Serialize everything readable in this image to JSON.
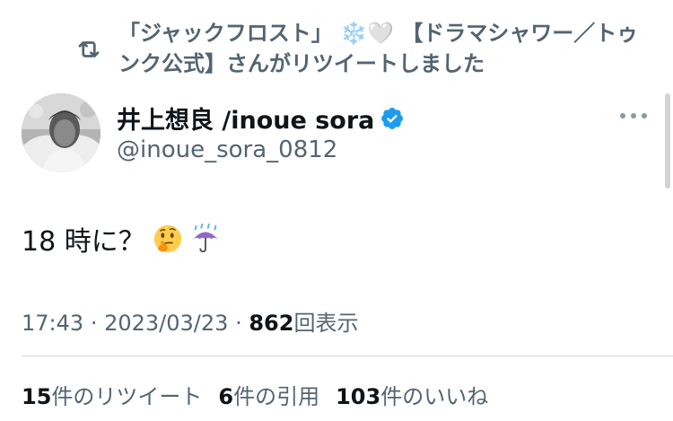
{
  "retweet_context": {
    "icon": "retweet-icon",
    "prefix": "「ジャックフロスト」",
    "emoji_snow": "❄️",
    "emoji_heart": "🤍",
    "suffix": "【ドラマシャワー／トゥンク公式】さんがリツイートしました"
  },
  "author": {
    "display_name": "井上想良 /inoue sora",
    "handle": "@inoue_sora_0812",
    "verified": true,
    "avatar_icon": "avatar-photo"
  },
  "tweet": {
    "text": "18 時に？",
    "emojis": [
      "thinking-face",
      "umbrella-with-rain"
    ]
  },
  "meta": {
    "time": "17:43",
    "separator": "·",
    "date": "2023/03/23",
    "views_count": "862",
    "views_label": "回表示"
  },
  "stats": {
    "retweets_count": "15",
    "retweets_label": "件のリツイート",
    "quotes_count": "6",
    "quotes_label": "件の引用",
    "likes_count": "103",
    "likes_label": "件のいいね"
  },
  "colors": {
    "secondary_text": "#536471",
    "primary_text": "#0f1419",
    "verified_blue": "#1d9bf0"
  }
}
